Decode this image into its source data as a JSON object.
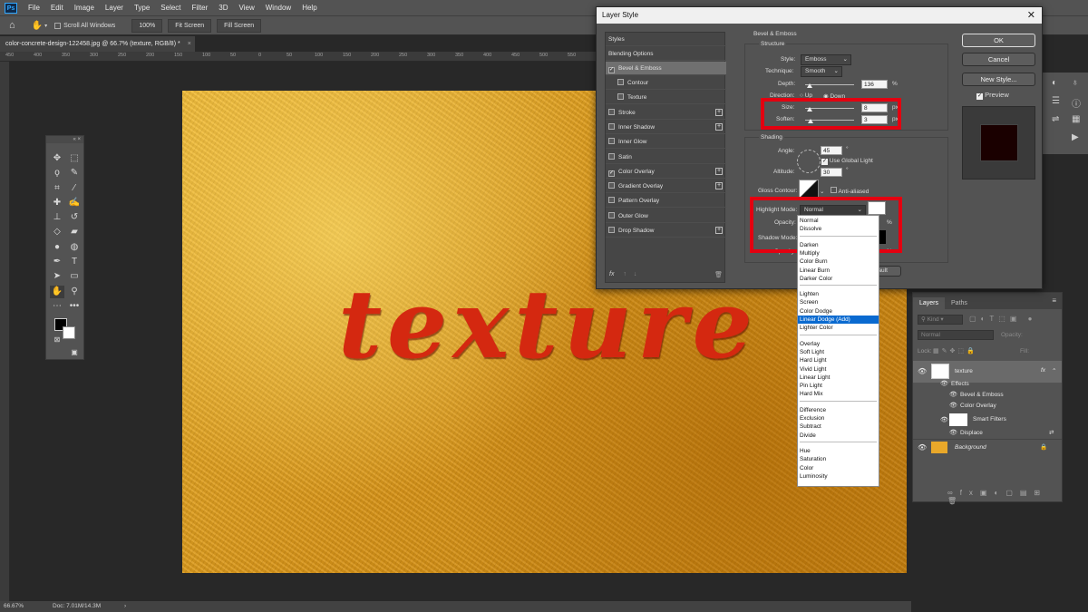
{
  "app": {
    "logo_text": "Ps"
  },
  "menu": [
    "File",
    "Edit",
    "Image",
    "Layer",
    "Type",
    "Select",
    "Filter",
    "3D",
    "View",
    "Window",
    "Help"
  ],
  "options_bar": {
    "scroll_all_label": "Scroll All Windows",
    "zoom_btn": "100%",
    "fit_btn": "Fit Screen",
    "fill_btn": "Fill Screen"
  },
  "document": {
    "tab_title": "color-concrete-design-122458.jpg @ 66.7% (texture, RGB/8) *",
    "close": "×"
  },
  "ruler_labels": [
    "450",
    "400",
    "350",
    "300",
    "250",
    "200",
    "150",
    "100",
    "50",
    "0",
    "50",
    "100",
    "150",
    "200",
    "250",
    "300",
    "350",
    "400",
    "450",
    "500",
    "550",
    "600",
    "650",
    "700",
    "750",
    "800",
    "850",
    "900",
    "950",
    "1000",
    "1050",
    "1100"
  ],
  "canvas": {
    "text": "texture"
  },
  "status": {
    "zoom": "66.67%",
    "doc": "Doc: 7.01M/14.3M"
  },
  "layers_panel": {
    "tabs": [
      "Layers",
      "Paths"
    ],
    "kind": "Kind",
    "blend": "Normal",
    "opacity_label": "Opacity:",
    "lock_label": "Lock:",
    "fill_label": "Fill:",
    "layers": [
      {
        "name": "texture",
        "fx": "fx"
      },
      {
        "name": "Effects"
      },
      {
        "name": "Bevel & Emboss"
      },
      {
        "name": "Color Overlay"
      },
      {
        "name": "Smart Filters"
      },
      {
        "name": "Displace"
      },
      {
        "name": "Background"
      }
    ]
  },
  "dialog": {
    "title": "Layer Style",
    "styles_header": "Styles",
    "style_items": [
      {
        "label": "Blending Options",
        "checked": false,
        "plus": false
      },
      {
        "label": "Bevel & Emboss",
        "checked": true,
        "plus": false,
        "selected": true
      },
      {
        "label": "Contour",
        "checked": false,
        "plus": false,
        "sub": true
      },
      {
        "label": "Texture",
        "checked": false,
        "plus": false,
        "sub": true
      },
      {
        "label": "Stroke",
        "checked": false,
        "plus": true
      },
      {
        "label": "Inner Shadow",
        "checked": false,
        "plus": true
      },
      {
        "label": "Inner Glow",
        "checked": false,
        "plus": false
      },
      {
        "label": "Satin",
        "checked": false,
        "plus": false
      },
      {
        "label": "Color Overlay",
        "checked": true,
        "plus": true
      },
      {
        "label": "Gradient Overlay",
        "checked": false,
        "plus": true
      },
      {
        "label": "Pattern Overlay",
        "checked": false,
        "plus": false
      },
      {
        "label": "Outer Glow",
        "checked": false,
        "plus": false
      },
      {
        "label": "Drop Shadow",
        "checked": false,
        "plus": true
      }
    ],
    "fx_label": "fx",
    "section": "Bevel & Emboss",
    "structure": "Structure",
    "style_label": "Style:",
    "style_value": "Emboss",
    "technique_label": "Technique:",
    "technique_value": "Smooth",
    "depth_label": "Depth:",
    "depth_value": "136",
    "depth_unit": "%",
    "direction_label": "Direction:",
    "dir_up": "Up",
    "dir_down": "Down",
    "size_label": "Size:",
    "size_value": "8",
    "size_unit": "px",
    "soften_label": "Soften:",
    "soften_value": "3",
    "soften_unit": "px",
    "shading": "Shading",
    "angle_label": "Angle:",
    "angle_value": "45",
    "angle_unit": "°",
    "global_light": "Use Global Light",
    "altitude_label": "Altitude:",
    "altitude_value": "30",
    "altitude_unit": "°",
    "gloss_label": "Gloss Contour:",
    "anti_aliased": "Anti-aliased",
    "highlight_label": "Highlight Mode:",
    "highlight_value": "Normal",
    "opacity_label": "Opacity:",
    "pct": "%",
    "shadow_label": "Shadow Mode:",
    "make_default": "efault",
    "ok": "OK",
    "cancel": "Cancel",
    "new_style": "New Style...",
    "preview": "Preview"
  },
  "blend_modes": [
    [
      "Normal",
      "Dissolve"
    ],
    [
      "Darken",
      "Multiply",
      "Color Burn",
      "Linear Burn",
      "Darker Color"
    ],
    [
      "Lighten",
      "Screen",
      "Color Dodge",
      "Linear Dodge (Add)",
      "Lighter Color"
    ],
    [
      "Overlay",
      "Soft Light",
      "Hard Light",
      "Vivid Light",
      "Linear Light",
      "Pin Light",
      "Hard Mix"
    ],
    [
      "Difference",
      "Exclusion",
      "Subtract",
      "Divide"
    ],
    [
      "Hue",
      "Saturation",
      "Color",
      "Luminosity"
    ]
  ],
  "blend_highlighted": "Linear Dodge (Add)",
  "colors": {
    "accent_red": "#e30010",
    "text_red": "#d42810",
    "highlight_blue": "#0a6ad0"
  }
}
